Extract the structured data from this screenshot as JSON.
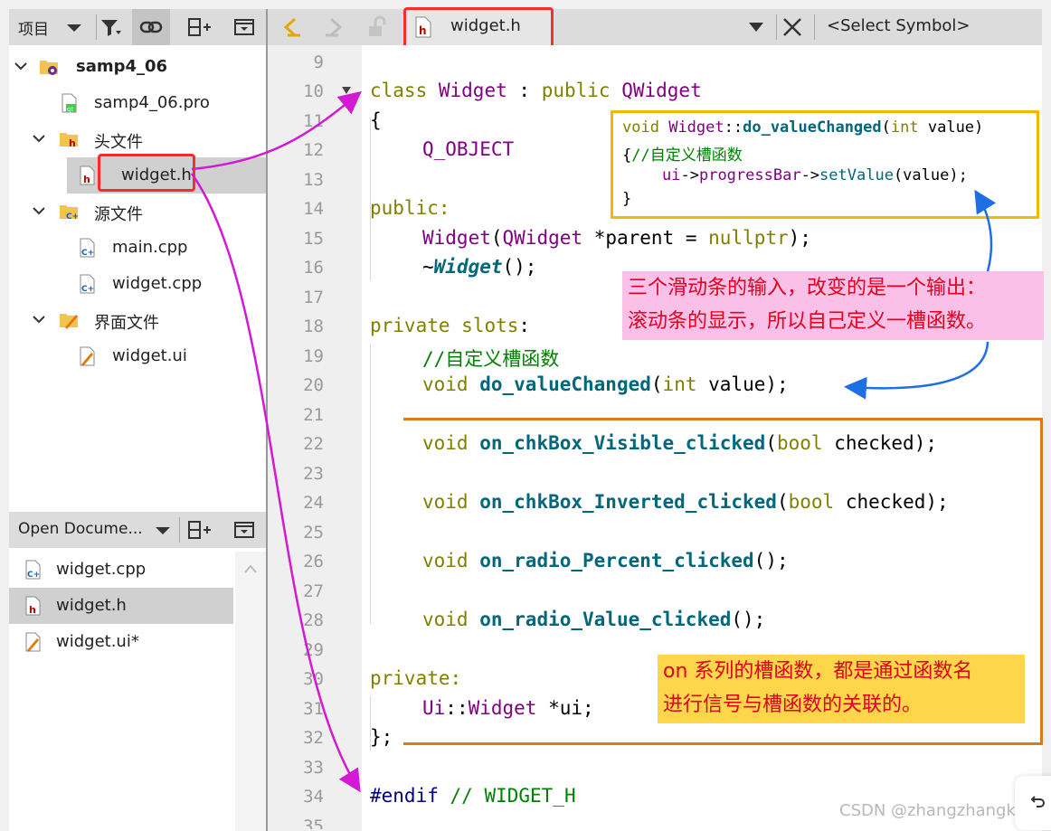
{
  "project_panel": {
    "toolbar": {
      "title": "项目"
    },
    "tree": [
      {
        "label": "samp4_06",
        "bold": true
      },
      {
        "label": "samp4_06.pro"
      },
      {
        "label": "头文件"
      },
      {
        "label": "widget.h",
        "selected": true
      },
      {
        "label": "源文件"
      },
      {
        "label": "main.cpp"
      },
      {
        "label": "widget.cpp"
      },
      {
        "label": "界面文件"
      },
      {
        "label": "widget.ui"
      }
    ]
  },
  "open_documents": {
    "title": "Open Docume...",
    "items": [
      {
        "label": "widget.cpp"
      },
      {
        "label": "widget.h",
        "selected": true
      },
      {
        "label": "widget.ui*"
      }
    ]
  },
  "editor_toolbar": {
    "file_tab": "widget.h",
    "symbol_select": "<Select Symbol>"
  },
  "line_numbers": [
    "9",
    "10",
    "11",
    "12",
    "13",
    "14",
    "15",
    "16",
    "17",
    "18",
    "19",
    "20",
    "21",
    "22",
    "23",
    "24",
    "25",
    "26",
    "27",
    "28",
    "29",
    "30",
    "31",
    "32",
    "33",
    "34",
    "35"
  ],
  "code": {
    "l10": [
      "class",
      "Widget",
      ":",
      "public",
      "QWidget"
    ],
    "l11": "{",
    "l12": "Q_OBJECT",
    "l14": "public:",
    "l15": [
      "Widget",
      "(",
      "QWidget",
      "*parent =",
      "nullptr",
      ");"
    ],
    "l16": [
      "~",
      "Widget",
      "();"
    ],
    "l18": [
      "private",
      "slots",
      ":"
    ],
    "l19": "//自定义槽函数",
    "l20": [
      "void",
      "do_valueChanged",
      "(",
      "int",
      "value);"
    ],
    "l22": [
      "void",
      "on_chkBox_Visible_clicked",
      "(",
      "bool",
      "checked);"
    ],
    "l24": [
      "void",
      "on_chkBox_Inverted_clicked",
      "(",
      "bool",
      "checked);"
    ],
    "l26": [
      "void",
      "on_radio_Percent_clicked",
      "();"
    ],
    "l28": [
      "void",
      "on_radio_Value_clicked",
      "();"
    ],
    "l30": "private:",
    "l31": [
      "Ui",
      "::",
      "Widget",
      "*ui;"
    ],
    "l32": "};",
    "l34": [
      "#endif",
      "// WIDGET_H"
    ]
  },
  "annotations": {
    "code_note": {
      "line1": [
        "void",
        "Widget",
        "::",
        "do_valueChanged",
        "(",
        "int",
        "value)"
      ],
      "line2": [
        "{",
        "//自定义槽函数"
      ],
      "line3": [
        "ui",
        "->",
        "progressBar",
        "->",
        "setValue",
        "(value);"
      ],
      "line4": "}"
    },
    "pink_note": [
      "三个滑动条的输入，改变的是一个输出：",
      "滚动条的显示，所以自己定义一槽函数。"
    ],
    "yellow_note": [
      "on 系列的槽函数，都是通过函数名",
      "进行信号与槽函数的关联的。"
    ],
    "watermark": "CSDN @zhangzhangkeji"
  },
  "colors": {
    "red_highlight": "#ff2a2a",
    "magenta_arrow": "#d21ad2",
    "blue_arrow": "#1e6fe6",
    "orange_frame": "#e0791a",
    "yellow_frame": "#f5b800"
  }
}
